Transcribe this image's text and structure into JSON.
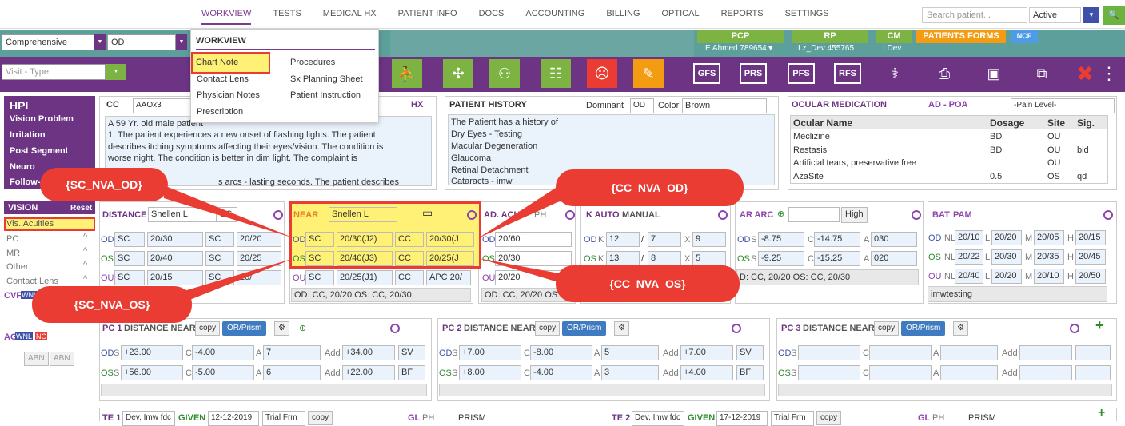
{
  "nav": {
    "items": [
      "WORKVIEW",
      "TESTS",
      "MEDICAL HX",
      "PATIENT INFO",
      "DOCS",
      "ACCOUNTING",
      "BILLING",
      "OPTICAL",
      "REPORTS",
      "SETTINGS"
    ],
    "active": "WORKVIEW"
  },
  "search": {
    "placeholder": "Search patient..."
  },
  "status": {
    "value": "Active"
  },
  "row2": {
    "exam_select": "Comprehensive",
    "eye_select": "OD",
    "visit_type_placeholder": "Visit - Type",
    "pcp": "PCP",
    "pcp_name": "E Ahmed 789654",
    "rp": "RP",
    "rp_name": "I z_Dev 455765",
    "cm": "CM",
    "cm_name": "I Dev",
    "patients_forms": "PATIENTS FORMS",
    "ncf": "NCF"
  },
  "toolbar": {
    "gfs": "GFS",
    "prs": "PRS",
    "pfs": "PFS",
    "rfs": "RFS"
  },
  "dropdown": {
    "title": "WORKVIEW",
    "items": [
      "Chart Note",
      "Contact Lens",
      "Physician Notes",
      "Prescription",
      "Procedures",
      "Sx Planning Sheet",
      "Patient Instruction"
    ]
  },
  "hpi": {
    "title": "HPI",
    "items": [
      "Vision Problem",
      "Irritation",
      "Post Segment",
      "Neuro",
      "Follow-"
    ]
  },
  "cc": {
    "label": "CC",
    "code": "AAOx3",
    "hx": "HX",
    "lines": [
      "A 59 Yr. old male patient",
      "1. The patient experiences a new onset of flashing lights.  The patient",
      "describes itching symptoms affecting their eyes/vision.  The condition is",
      "worse night.  The condition is better in dim light.  The complaint is",
      "s arcs - lasting seconds.  The patient describes"
    ]
  },
  "patient_history": {
    "title": "PATIENT HISTORY",
    "dominant_label": "Dominant",
    "dominant": "OD",
    "color_label": "Color",
    "color": "Brown",
    "lines": [
      "The Patient has a history of",
      "Dry Eyes - Testing",
      "Macular Degeneration",
      "Glaucoma",
      "Retinal Detachment",
      "Cataracts - imw"
    ]
  },
  "ocular_med": {
    "title": "OCULAR MEDICATION",
    "adpoa": "AD - POA",
    "pain": "-Pain Level-",
    "headers": [
      "Ocular Name",
      "Dosage",
      "Site",
      "Sig."
    ],
    "rows": [
      [
        "Meclizine",
        "BD",
        "OU",
        ""
      ],
      [
        "Restasis",
        "BD",
        "OU",
        "bid"
      ],
      [
        "Artificial tears, preservative free",
        "",
        "OU",
        ""
      ],
      [
        "AzaSite",
        "0.5",
        "OS",
        "qd"
      ]
    ]
  },
  "vision": {
    "title": "VISION",
    "reset": "Reset",
    "items": [
      "Vis. Acuities",
      "PC",
      "MR",
      "Other",
      "Contact Lens"
    ],
    "cvf": "CVF",
    "wnl": "WNL",
    "ag": "AG",
    "nc": "NC",
    "abn": "ABN"
  },
  "distance": {
    "title": "DISTANCE",
    "type": "Snellen L",
    "sc": "SC",
    "rows": [
      [
        "OD",
        "SC",
        "20/30",
        "SC",
        "20/20"
      ],
      [
        "OS",
        "SC",
        "20/40",
        "SC",
        "20/25"
      ],
      [
        "OU",
        "SC",
        "20/15",
        "SC",
        "20/"
      ]
    ]
  },
  "near": {
    "title": "NEAR",
    "type": "Snellen L",
    "rows": [
      [
        "OD",
        "SC",
        "20/30(J2)",
        "CC",
        "20/30(J"
      ],
      [
        "OS",
        "SC",
        "20/40(J3)",
        "CC",
        "20/25(J"
      ],
      [
        "OU",
        "SC",
        "20/25(J1)",
        "CC",
        "APC 20/"
      ]
    ],
    "note": "OD: CC, 20/20 OS: CC, 20/30"
  },
  "adacuity": {
    "title": "AD. ACUI",
    "ph": "PH",
    "rows": [
      [
        "OD",
        "20/60"
      ],
      [
        "OS",
        "20/30"
      ],
      [
        "OU",
        "20/20"
      ]
    ],
    "note": "OD: CC, 20/20 OS:"
  },
  "kauto": {
    "title": "K AUTO",
    "manual": "MANUAL",
    "rows": [
      [
        "OD",
        "K",
        "12",
        "/",
        "7",
        "X",
        "9"
      ],
      [
        "OS",
        "K",
        "13",
        "/",
        "8",
        "X",
        "5"
      ]
    ]
  },
  "arc": {
    "title": "AR ARC",
    "high": "High",
    "rows": [
      [
        "OD",
        "S",
        "-8.75",
        "C",
        "-14.75",
        "A",
        "030"
      ],
      [
        "OS",
        "S",
        "-9.25",
        "C",
        "-15.25",
        "A",
        "020"
      ]
    ],
    "note": "D: CC, 20/20 OS: CC, 20/30"
  },
  "bat": {
    "title": "BAT",
    "pam": "PAM",
    "rows": [
      [
        "OD",
        "NL",
        "20/10",
        "L",
        "20/20",
        "M",
        "20/05",
        "H",
        "20/15"
      ],
      [
        "OS",
        "NL",
        "20/22",
        "L",
        "20/30",
        "M",
        "20/35",
        "H",
        "20/45"
      ],
      [
        "OU",
        "NL",
        "20/40",
        "L",
        "20/20",
        "M",
        "20/10",
        "H",
        "20/50"
      ]
    ],
    "note": "imwtesting"
  },
  "pc1": {
    "title": "PC 1",
    "sub": "DISTANCE NEAR",
    "copy": "copy",
    "orprism": "OR/Prism",
    "rows": [
      [
        "OD",
        "S",
        "+23.00",
        "C",
        "-4.00",
        "A",
        "7",
        "Add",
        "+34.00",
        "SV"
      ],
      [
        "OS",
        "S",
        "+56.00",
        "C",
        "-5.00",
        "A",
        "6",
        "Add",
        "+22.00",
        "BF"
      ]
    ]
  },
  "pc2": {
    "title": "PC 2",
    "sub": "DISTANCE NEAR",
    "copy": "copy",
    "orprism": "OR/Prism",
    "rows": [
      [
        "OD",
        "S",
        "+7.00",
        "C",
        "-8.00",
        "A",
        "5",
        "Add",
        "+7.00",
        "SV"
      ],
      [
        "OS",
        "S",
        "+8.00",
        "C",
        "-4.00",
        "A",
        "3",
        "Add",
        "+4.00",
        "BF"
      ]
    ]
  },
  "pc3": {
    "title": "PC 3",
    "sub": "DISTANCE NEAR",
    "copy": "copy",
    "orprism": "OR/Prism",
    "rows": [
      [
        "OD",
        "S",
        "",
        "C",
        "",
        "A",
        "",
        "Add",
        "",
        ""
      ],
      [
        "OS",
        "S",
        "",
        "C",
        "",
        "A",
        "",
        "Add",
        "",
        ""
      ]
    ]
  },
  "bottom": {
    "te1": "TE 1",
    "te1_text": "Dev, Imw fdc",
    "given": "GIVEN",
    "date1": "12-12-2019",
    "trial": "Trial Frm",
    "copy": "copy",
    "gl": "GL",
    "ph": "PH",
    "prism": "PRISM",
    "te2": "TE 2",
    "te2_text": "Dev, Imw fdc",
    "date2": "17-12-2019"
  },
  "callouts": {
    "sc_nva_od": "{SC_NVA_OD}",
    "sc_nva_os": "{SC_NVA_OS}",
    "cc_nva_od": "{CC_NVA_OD}",
    "cc_nva_os": "{CC_NVA_OS}"
  },
  "colors": {
    "purple": "#6c3483",
    "green": "#7cb342",
    "teal": "#5d9f9a",
    "red": "#ea3c33",
    "yellow": "#fff176"
  }
}
